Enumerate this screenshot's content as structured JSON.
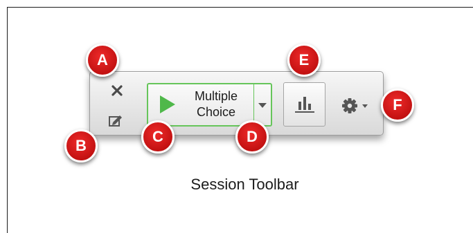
{
  "callouts": [
    "A",
    "B",
    "C",
    "D",
    "E",
    "F"
  ],
  "toolbar": {
    "start_button_label_line1": "Multiple",
    "start_button_label_line2": "Choice",
    "icons": {
      "close": "close-icon",
      "edit": "edit-icon",
      "play": "play-icon",
      "dropdown": "chevron-down-icon",
      "results": "bar-chart-icon",
      "settings": "gear-icon"
    },
    "accent_color": "#66c55a"
  },
  "caption": "Session Toolbar",
  "colors": {
    "callout": "#d91a1a",
    "play": "#4fb84a",
    "icon": "#555555"
  }
}
